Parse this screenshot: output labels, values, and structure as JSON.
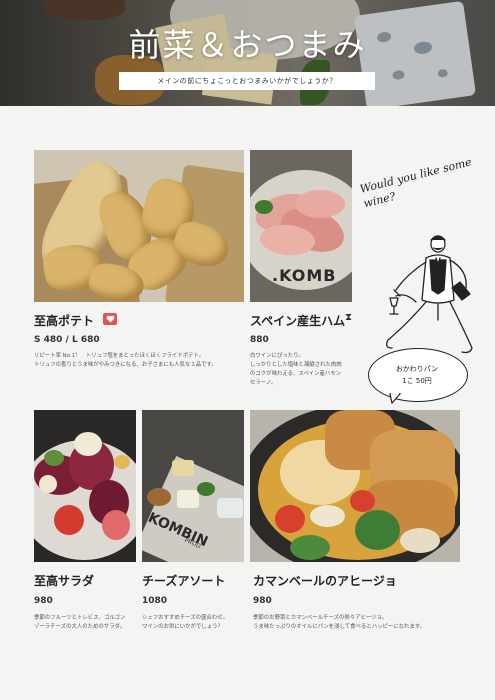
{
  "header": {
    "title": "前菜＆おつまみ",
    "subtitle": "メインの前にちょこっとおつまみいかがでしょうか？"
  },
  "waiter": {
    "speech": "Would you like some wine?",
    "bubble_line1": "おかわりパン",
    "bubble_line2": "1こ 50円"
  },
  "menu": [
    {
      "name": "至高ポテト",
      "price": "S 480 / L 680",
      "desc_line1": "リピート率 No.1！　トリュフ塩をまとったほくほくフライドポテト。",
      "desc_line2": "トリュフの香りとうま味がやみつきになる、お子さまにも人気な１品です。",
      "badge_icon": "heart-icon"
    },
    {
      "name": "スペイン産生ハム",
      "price": "880",
      "desc_line1": "白ワインにぴったり。",
      "desc_line2": "しっかりとした塩味と凝縮された肉肉",
      "desc_line3": "のコクが味わえる、スペイン産ハモン",
      "desc_line4": "セラーノ。",
      "badge_icon": "hourglass-icon"
    },
    {
      "name": "至高サラダ",
      "price": "980",
      "desc_line1": "季節のフルーツとトレビス、ゴルゴン",
      "desc_line2": "ゾーラチーズの大人のためのサラダ。"
    },
    {
      "name": "チーズアソート",
      "price": "1080",
      "desc_line1": "シェフおすすめチーズの盛合わせ。",
      "desc_line2": "ワインのお供にいかがでしょう？"
    },
    {
      "name": "カマンベールのアヒージョ",
      "price": "980",
      "desc_line1": "季節のお野菜とカマンベールチーズの熱々アヒージョ。",
      "desc_line2": "うま味たっぷりのオイルにパンを浸して食べるとハッピーになれます。"
    }
  ],
  "photo_text": {
    "ham_plate": ".KOMB",
    "cheese_board": "KOMBIN",
    "cheese_board_small": "PROD"
  },
  "colors": {
    "badge": "#e35555",
    "background": "#f4f4f2"
  }
}
